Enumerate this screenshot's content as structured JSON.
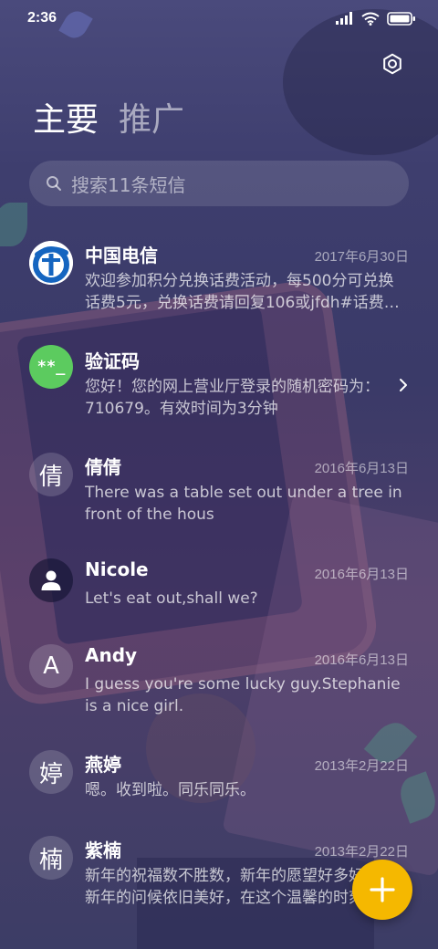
{
  "status_bar": {
    "time": "2:36"
  },
  "tabs": [
    {
      "label": "主要",
      "active": true
    },
    {
      "label": "推广",
      "active": false
    }
  ],
  "search": {
    "placeholder": "搜索11条短信"
  },
  "conversations": [
    {
      "name": "中国电信",
      "date": "2017年6月30日",
      "preview": "欢迎参加积分兑换话费活动，每500分可兑换话费5元，兑换话费请回复106或jfdh#话费…",
      "avatar_type": "logo",
      "avatar_icon": "china-telecom-logo-icon"
    },
    {
      "name": "验证码",
      "date": "",
      "preview": "您好！您的网上营业厅登录的随机密码为：710679。有效时间为3分钟",
      "avatar_type": "text",
      "avatar_text": "**_",
      "avatar_color": "#5ccb5f",
      "has_chevron": true
    },
    {
      "name": "倩倩",
      "date": "2016年6月13日",
      "preview": "There was a table set out under a tree in front of the hous",
      "avatar_type": "text",
      "avatar_text": "倩"
    },
    {
      "name": "Nicole",
      "date": "2016年6月13日",
      "preview": "Let's eat out,shall we?",
      "avatar_type": "icon",
      "avatar_icon": "person-icon"
    },
    {
      "name": "Andy",
      "date": "2016年6月13日",
      "preview": "I guess you're some lucky guy.Stephanie is a nice girl.",
      "avatar_type": "text",
      "avatar_text": "A"
    },
    {
      "name": "燕婷",
      "date": "2013年2月22日",
      "preview": "嗯。收到啦。同乐同乐。",
      "avatar_type": "text",
      "avatar_text": "婷"
    },
    {
      "name": "紫楠",
      "date": "2013年2月22日",
      "preview": "新年的祝福数不胜数，新年的愿望好多好多，新年的问候依旧美好，在这个温馨的时刻",
      "avatar_type": "text",
      "avatar_text": "楠"
    }
  ],
  "colors": {
    "accent": "#f5b800",
    "verification_green": "#5ccb5f",
    "telecom_blue": "#1565c0"
  },
  "icons": {
    "settings": "gear-icon",
    "search": "search-icon",
    "compose": "plus-icon"
  }
}
